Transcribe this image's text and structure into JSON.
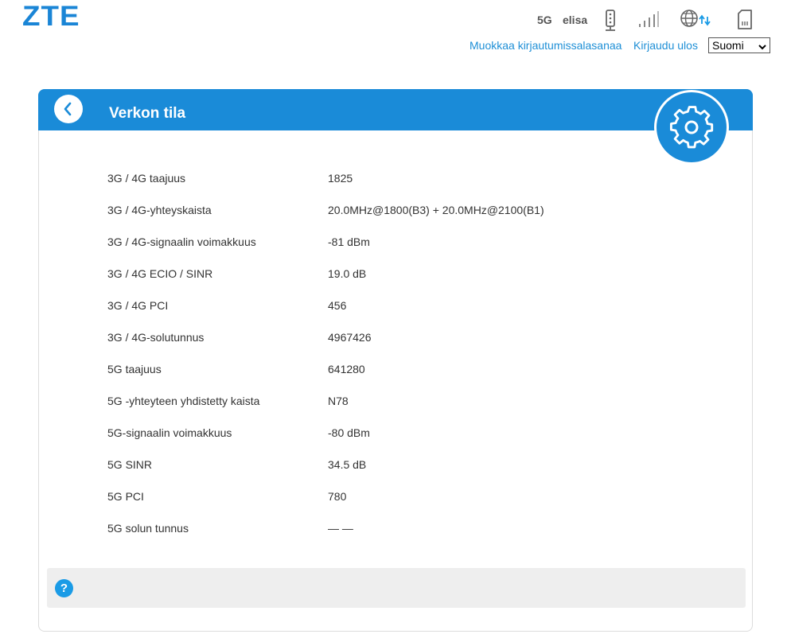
{
  "brand": {
    "logo": "ZTE"
  },
  "status_bar": {
    "network_type": "5G",
    "operator": "elisa",
    "icons": [
      "device-status-icon",
      "signal-strength-icon",
      "internet-connection-icon",
      "sim-card-icon"
    ]
  },
  "header_links": {
    "change_password": "Muokkaa kirjautumissalasanaa",
    "logout": "Kirjaudu ulos"
  },
  "language": {
    "selected": "Suomi"
  },
  "page": {
    "title": "Verkon tila",
    "rows": [
      {
        "label": "3G / 4G taajuus",
        "value": "1825"
      },
      {
        "label": "3G / 4G-yhteyskaista",
        "value": "20.0MHz@1800(B3) + 20.0MHz@2100(B1)"
      },
      {
        "label": "3G / 4G-signaalin voimakkuus",
        "value": "-81 dBm"
      },
      {
        "label": "3G / 4G ECIO / SINR",
        "value": "19.0 dB"
      },
      {
        "label": "3G / 4G PCI",
        "value": "456"
      },
      {
        "label": "3G / 4G-solutunnus",
        "value": "4967426"
      },
      {
        "label": "5G taajuus",
        "value": "641280"
      },
      {
        "label": "5G -yhteyteen yhdistetty kaista",
        "value": "N78"
      },
      {
        "label": "5G-signaalin voimakkuus",
        "value": "-80 dBm"
      },
      {
        "label": "5G SINR",
        "value": "34.5 dB"
      },
      {
        "label": "5G PCI",
        "value": "780"
      },
      {
        "label": "5G solun tunnus",
        "value": "— —"
      }
    ]
  },
  "help": {
    "icon_glyph": "?"
  },
  "colors": {
    "accent": "#1a8bd8",
    "link": "#1e8fd6",
    "help_bar": "#eeeeee"
  }
}
